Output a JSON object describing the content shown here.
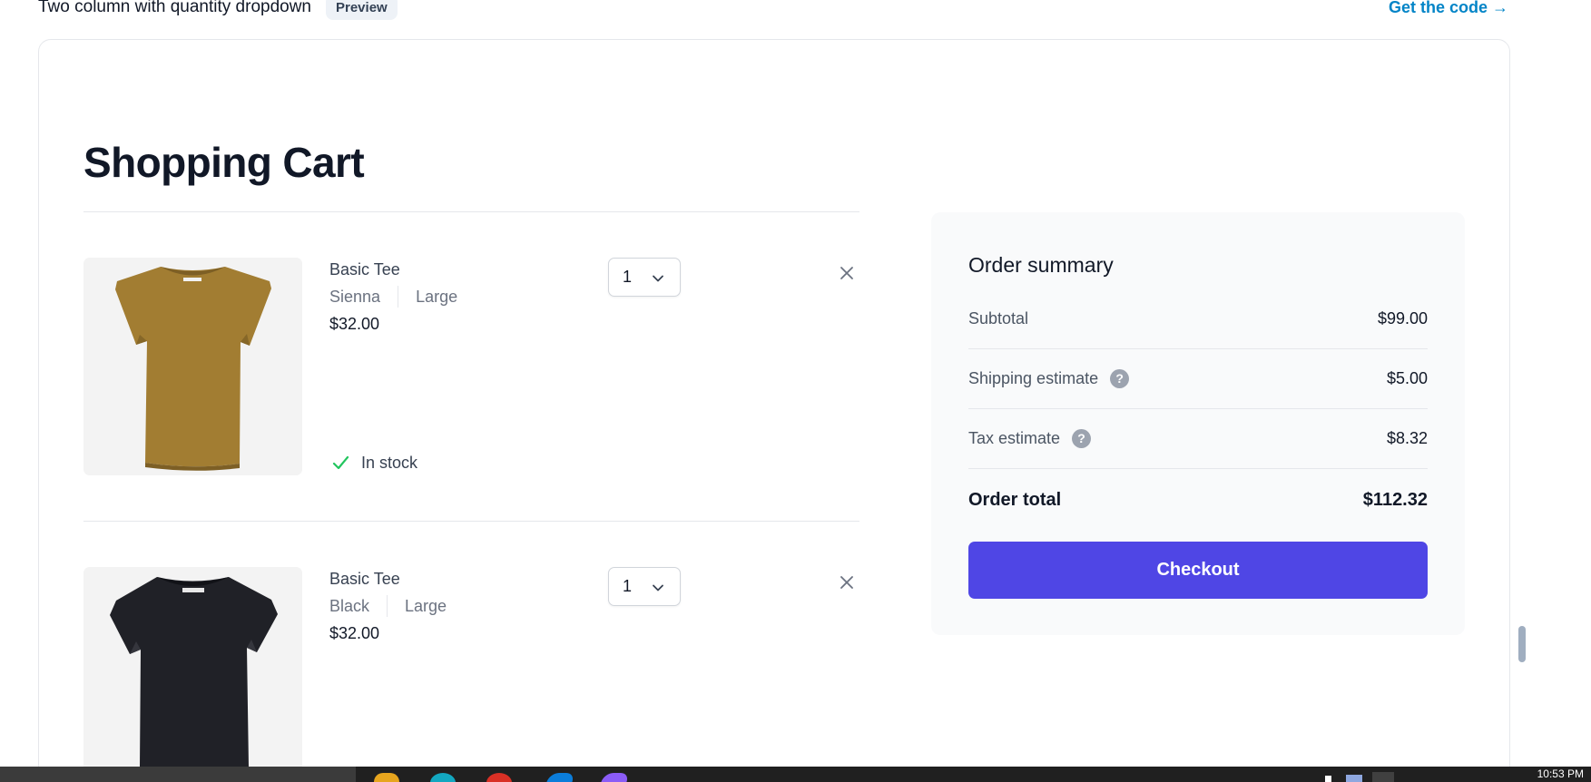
{
  "top": {
    "title": "Two column with quantity dropdown",
    "preview_label": "Preview",
    "code_link": "Get the code →"
  },
  "cart": {
    "title": "Shopping Cart",
    "items": [
      {
        "name": "Basic Tee",
        "color": "Sienna",
        "size": "Large",
        "price": "$32.00",
        "quantity": "1",
        "stock": "In stock",
        "shirt_color": "#a27d32"
      },
      {
        "name": "Basic Tee",
        "color": "Black",
        "size": "Large",
        "price": "$32.00",
        "quantity": "1",
        "shirt_color": "#202127"
      }
    ]
  },
  "summary": {
    "title": "Order summary",
    "subtotal_label": "Subtotal",
    "subtotal_value": "$99.00",
    "shipping_label": "Shipping estimate",
    "shipping_value": "$5.00",
    "tax_label": "Tax estimate",
    "tax_value": "$8.32",
    "total_label": "Order total",
    "total_value": "$112.32",
    "checkout_label": "Checkout"
  },
  "icons": {
    "remove": "close-icon",
    "dropdown": "chevron-down-icon",
    "stock": "check-icon",
    "help": "question-icon"
  },
  "colors": {
    "accent": "#4f46e5",
    "link": "#0284c7",
    "success": "#22c55e",
    "summary_bg": "#f9fafb"
  },
  "taskbar": {
    "time": "10:53 PM"
  }
}
